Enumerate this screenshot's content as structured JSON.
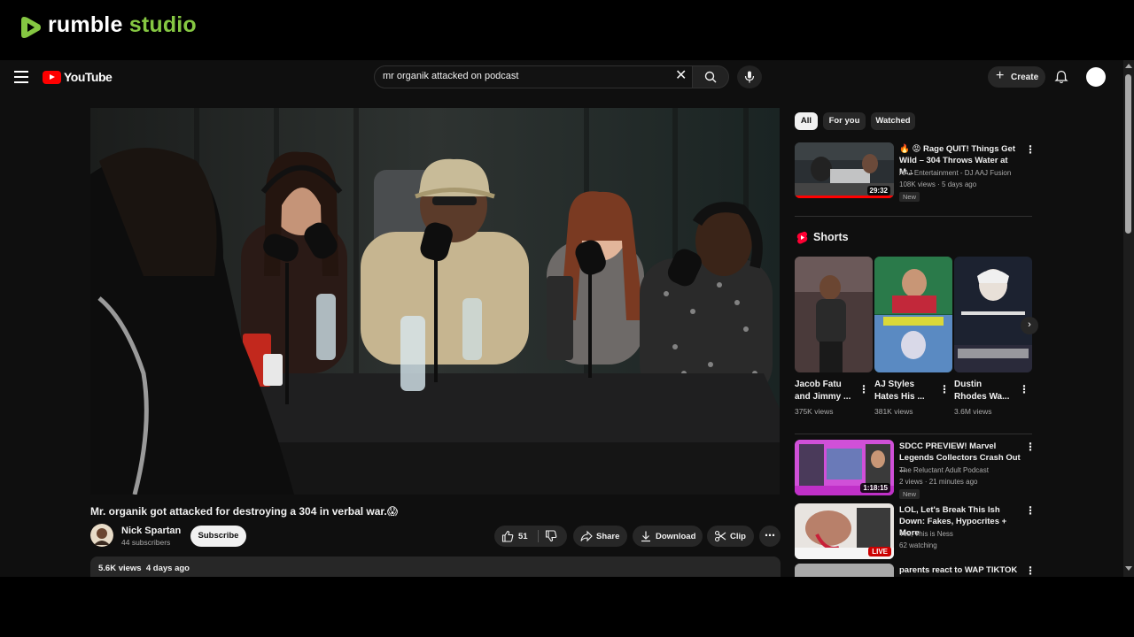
{
  "rumble": {
    "brand": "rumble",
    "studio": "studio",
    "accent": "#85c742"
  },
  "youtube": {
    "wordmark": "YouTube",
    "search": {
      "value": "mr organik attacked on podcast"
    },
    "create_label": "Create"
  },
  "video": {
    "title": "Mr. organik got attacked for destroying a 304 in verbal war.😱",
    "channel": "Nick Spartan",
    "subscribers": "44 subscribers",
    "subscribe_label": "Subscribe",
    "likes": "51",
    "share_label": "Share",
    "download_label": "Download",
    "clip_label": "Clip",
    "views": "5.6K views",
    "date": "4 days ago"
  },
  "chips": [
    "All",
    "For you",
    "Watched"
  ],
  "recs": [
    {
      "title": "🔥 😡 Rage QUIT! Things Get Wild – 304 Throws Water at M...",
      "channel": "AAJ Entertainment - DJ AAJ Fusion",
      "meta": "108K views · 5 days ago",
      "badge": "New",
      "duration": "29:32"
    },
    {
      "title": "SDCC PREVIEW! Marvel Legends Collectors Crash Out ...",
      "channel": "The Reluctant Adult Podcast",
      "meta": "2 views · 21 minutes ago",
      "badge": "New",
      "duration": "1:18:15"
    },
    {
      "title": "LOL, Let's Break This Ish Down: Fakes, Hypocrites + More",
      "channel": "Yes, This is Ness",
      "meta": "62 watching",
      "live": "LIVE"
    },
    {
      "title": "parents react to WAP TIKTOK"
    }
  ],
  "shorts": {
    "heading": "Shorts",
    "items": [
      {
        "title": "Jacob Fatu and Jimmy ...",
        "views": "375K views"
      },
      {
        "title": "AJ Styles Hates His ...",
        "views": "381K views"
      },
      {
        "title": "Dustin Rhodes Wa...",
        "views": "3.6M views"
      }
    ]
  }
}
